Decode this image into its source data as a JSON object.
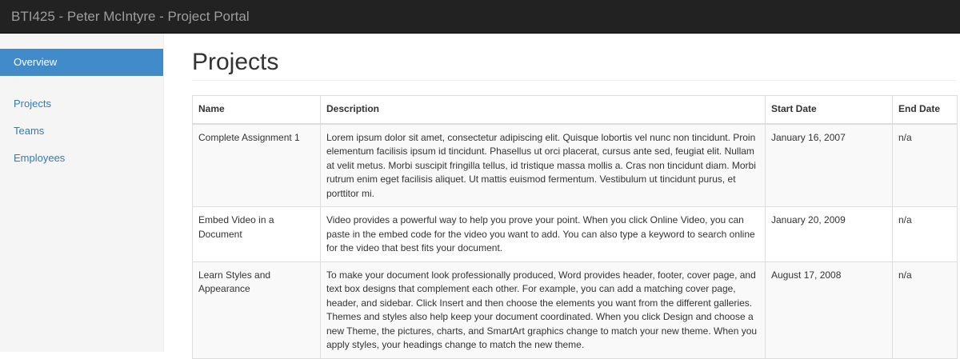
{
  "header": {
    "brand": "BTI425 - Peter McIntyre - Project Portal"
  },
  "sidebar": {
    "items": [
      {
        "label": "Overview",
        "active": true
      },
      {
        "label": "Projects",
        "active": false
      },
      {
        "label": "Teams",
        "active": false
      },
      {
        "label": "Employees",
        "active": false
      }
    ]
  },
  "main": {
    "title": "Projects",
    "table": {
      "columns": [
        "Name",
        "Description",
        "Start Date",
        "End Date"
      ],
      "rows": [
        {
          "name": "Complete Assignment 1",
          "description": "Lorem ipsum dolor sit amet, consectetur adipiscing elit. Quisque lobortis vel nunc non tincidunt. Proin elementum facilisis ipsum id tincidunt. Phasellus ut orci placerat, cursus ante sed, feugiat elit. Nullam at velit metus. Morbi suscipit fringilla tellus, id tristique massa mollis a. Cras non tincidunt diam. Morbi rutrum enim eget facilisis aliquet. Ut mattis euismod fermentum. Vestibulum ut tincidunt purus, et porttitor mi.",
          "start_date": "January 16, 2007",
          "end_date": "n/a"
        },
        {
          "name": "Embed Video in a Document",
          "description": "Video provides a powerful way to help you prove your point. When you click Online Video, you can paste in the embed code for the video you want to add. You can also type a keyword to search online for the video that best fits your document.",
          "start_date": "January 20, 2009",
          "end_date": "n/a"
        },
        {
          "name": "Learn Styles and Appearance",
          "description": "To make your document look professionally produced, Word provides header, footer, cover page, and text box designs that complement each other. For example, you can add a matching cover page, header, and sidebar. Click Insert and then choose the elements you want from the different galleries. Themes and styles also help keep your document coordinated. When you click Design and choose a new Theme, the pictures, charts, and SmartArt graphics change to match your new theme. When you apply styles, your headings change to match the new theme.",
          "start_date": "August 17, 2008",
          "end_date": "n/a"
        }
      ]
    }
  },
  "colors": {
    "navbar_bg": "#222222",
    "brand_text": "#9d9d9d",
    "sidebar_bg": "#f5f5f5",
    "active_nav_bg": "#428bca",
    "link": "#337ab7",
    "striped_row": "#f9f9f9",
    "border": "#dddddd"
  }
}
